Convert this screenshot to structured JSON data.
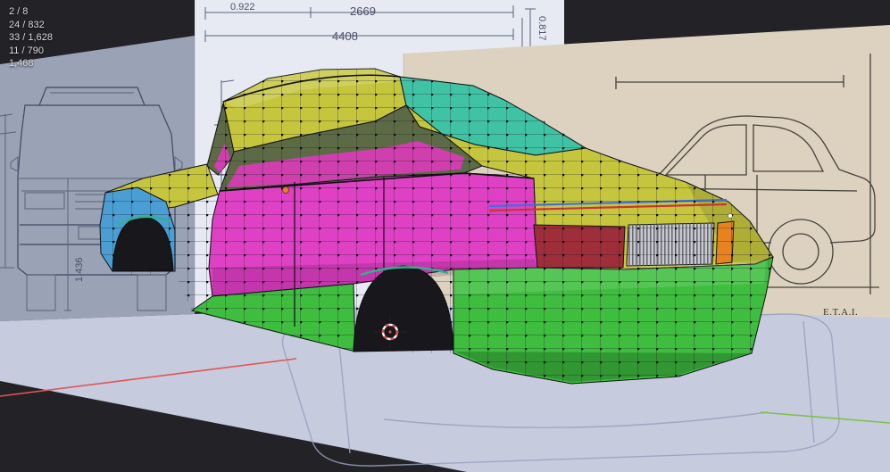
{
  "viewport": {
    "stats": [
      "2 / 8",
      "24 / 832",
      "33 / 1,628",
      "11 / 790",
      "1,468"
    ]
  },
  "blueprint": {
    "dims": {
      "rear_overhang": "0.922",
      "wheelbase": "2669",
      "length": "4408",
      "front_overhang": "0.817",
      "height": "1,436"
    },
    "label": "E.T.A.I."
  },
  "colors": {
    "bg": "#232327",
    "plane_light": "#e7eaf3",
    "plane_shaded": "#9aa2b6",
    "plane_beige": "#dcd2bf",
    "floor": "#c6cbde",
    "body_yellow": "#c6c63e",
    "glass_teal": "#3fc3a4",
    "glass_olive": "#5c6b45",
    "interior_magenta": "#cf3fae",
    "body_magenta": "#de41c4",
    "lower_green": "#3ebd3f",
    "arch_blue": "#4a9ed3",
    "tail_red": "#9e2f3a",
    "trim_silver": "#c9cacf",
    "accent_orange": "#e6831f",
    "stripe_blue": "#3f6fe0",
    "stripe_red": "#cc3434",
    "axis_red": "#e25555",
    "axis_green": "#7dc24a",
    "arch_dark": "#17171c",
    "cursor_red": "#d94a45"
  }
}
